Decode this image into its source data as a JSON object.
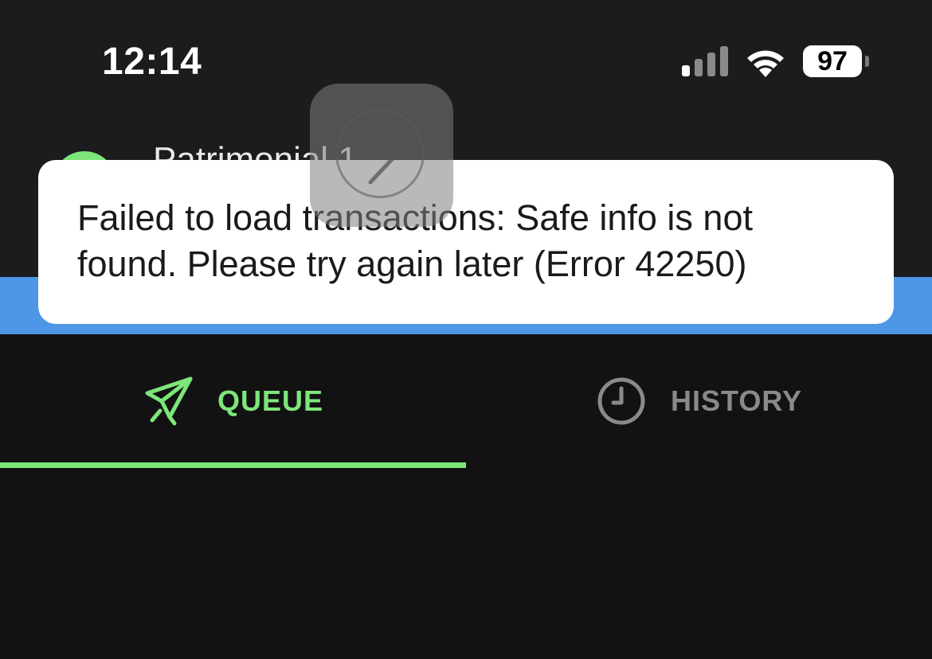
{
  "status_bar": {
    "time": "12:14",
    "battery_level": "97",
    "signal_icon": "cellular-signal-icon",
    "wifi_icon": "wifi-icon"
  },
  "safe_header": {
    "name": "Patrimonial 1"
  },
  "toast": {
    "message": "Failed to load transactions: Safe info is not found. Please try again later (Error 42250)"
  },
  "tabs": [
    {
      "label": "QUEUE",
      "icon": "rocket-icon",
      "active": true
    },
    {
      "label": "HISTORY",
      "icon": "clock-icon",
      "active": false
    }
  ],
  "colors": {
    "accent_green": "#7de67a",
    "banner_blue": "#4d97e6",
    "background": "#121212",
    "inactive_tab": "#8a8a8a"
  }
}
